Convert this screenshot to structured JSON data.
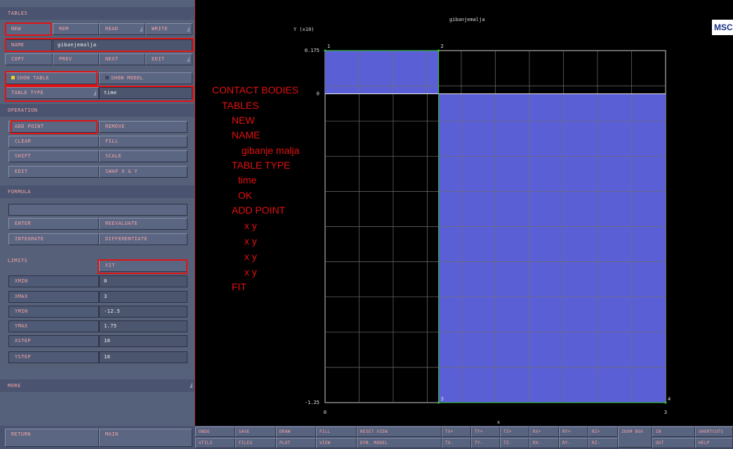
{
  "left_panel": {
    "tables_header": "TABLES",
    "row1": {
      "new": "NEW",
      "rem": "REM",
      "read": "READ",
      "write": "WRITE"
    },
    "name_label": "NAME",
    "name_value": "gibanjemalja",
    "row3": {
      "copy": "COPY",
      "prev": "PREV",
      "next": "NEXT",
      "edit": "EDIT"
    },
    "show_table": "SHOW TABLE",
    "show_model": "SHOW MODEL",
    "table_type_label": "TABLE TYPE",
    "table_type_value": "time",
    "operation_header": "OPERATION",
    "operation": {
      "add_point": "ADD POINT",
      "remove": "REMOVE",
      "clear": "CLEAR",
      "fill": "FILL",
      "shift": "SHIFT",
      "scale": "SCALE",
      "edit": "EDIT",
      "swap": "SWAP X & Y"
    },
    "formula_header": "FORMULA",
    "formula": {
      "enter": "ENTER",
      "reevaluate": "REEVALUATE",
      "integrate": "INTEGRATE",
      "differentiate": "DIFFERENTIATE"
    },
    "limits_header": "LIMITS",
    "fit": "FIT",
    "limits": [
      {
        "label": "XMIN",
        "value": "0"
      },
      {
        "label": "XMAX",
        "value": "3"
      },
      {
        "label": "YMIN",
        "value": "-12.5"
      },
      {
        "label": "YMAX",
        "value": "1.75"
      },
      {
        "label": "XSTEP",
        "value": "10"
      },
      {
        "label": "YSTEP",
        "value": "10"
      }
    ],
    "more": "MORE",
    "return": "RETURN",
    "main": "MAIN"
  },
  "toolbar": {
    "top": [
      "UNDO",
      "SAVE",
      "DRAW",
      "FILL",
      "RESET VIEW",
      "TX+",
      "TY+",
      "TZ+",
      "RX+",
      "RY+",
      "RZ+",
      "ZOOM BOX",
      "IN",
      "SHORTCUTS"
    ],
    "bottom": [
      "UTILS",
      "FILES",
      "PLOT",
      "VIEW",
      "DYN. MODEL",
      "TX-",
      "TY-",
      "TZ-",
      "RX-",
      "RY-",
      "RZ-",
      "",
      "OUT",
      "HELP"
    ]
  },
  "chart": {
    "title": "gibanjemalja",
    "ylabel": "Y (x10)",
    "xlabel": "x",
    "y_ticks": [
      "0.175",
      "0",
      "-1.25"
    ],
    "x_ticks": [
      "0",
      "3"
    ],
    "point_labels": [
      "1",
      "2",
      "3",
      "4"
    ],
    "fill_color": "#5b5fd6",
    "logo_text": "MSC"
  },
  "chart_data": {
    "type": "area",
    "title": "gibanjemalja",
    "xlabel": "x",
    "ylabel": "Y (x10)",
    "xlim": [
      0,
      3
    ],
    "ylim": [
      -1.25,
      0.175
    ],
    "grid": true,
    "points": [
      {
        "label": "1",
        "x": 0,
        "y": 0.175
      },
      {
        "label": "2",
        "x": 1,
        "y": 0.175
      },
      {
        "label": "3",
        "x": 1,
        "y": -1.25
      },
      {
        "label": "4",
        "x": 3,
        "y": -1.25
      }
    ]
  },
  "annotations": [
    "CONTACT BODIES",
    "TABLES",
    "NEW",
    "NAME",
    "gibanje malja",
    "TABLE TYPE",
    "time",
    "OK",
    "ADD POINT",
    "x   y",
    "x   y",
    "x   y",
    "x   y",
    "FIT"
  ]
}
